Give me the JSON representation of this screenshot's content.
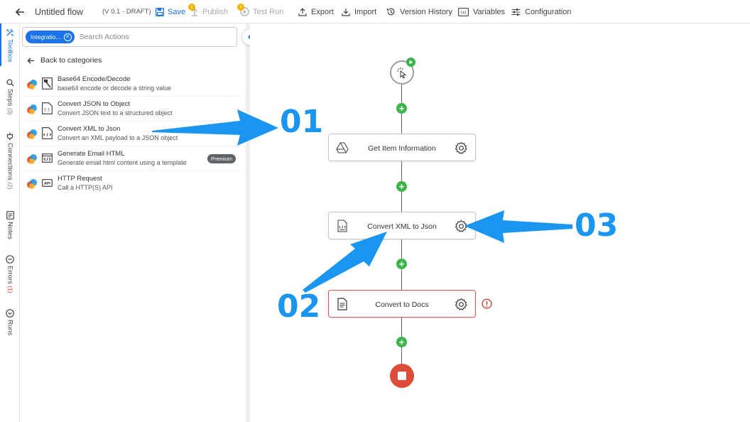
{
  "header": {
    "title": "Untitled flow",
    "version": "(V 0.1 - DRAFT)",
    "save": "Save",
    "publish": "Publish",
    "test_run": "Test Run",
    "export": "Export",
    "import": "Import",
    "version_history": "Version History",
    "variables": "Variables",
    "configuration": "Configuration",
    "publish_badge": "!",
    "test_run_badge": "!"
  },
  "rail": {
    "toolbox": "Toolbox",
    "steps": "Steps",
    "steps_count": "(3)",
    "connections": "Connections",
    "connections_count": "(2)",
    "notes": "Notes",
    "errors": "Errors",
    "errors_count": "(1)",
    "runs": "Runs"
  },
  "toolbox": {
    "filter_chip": "Integratio...",
    "search_placeholder": "Search Actions",
    "back_label": "Back to categories",
    "actions": [
      {
        "name": "Base64 Encode/Decode",
        "description": "base64 encode or decode a string value",
        "badge": ""
      },
      {
        "name": "Convert JSON to Object",
        "description": "Convert JSON text to a structured object",
        "badge": ""
      },
      {
        "name": "Convert XML to Json",
        "description": "Convert an XML payload to a JSON object",
        "badge": ""
      },
      {
        "name": "Generate Email HTML",
        "description": "Generate email html content using a template",
        "badge": "Premium"
      },
      {
        "name": "HTTP Request",
        "description": "Call a HTTP(S) API",
        "badge": ""
      }
    ]
  },
  "canvas": {
    "steps": [
      {
        "label": "Get Item Information",
        "icon": "google-drive-icon",
        "state": "ok"
      },
      {
        "label": "Convert XML to Json",
        "icon": "xml-file-icon",
        "state": "ok"
      },
      {
        "label": "Convert to Docs",
        "icon": "document-icon",
        "state": "error"
      }
    ]
  },
  "annotations": {
    "n1": "01",
    "n2": "02",
    "n3": "03",
    "color": "#1a95f0"
  },
  "colors": {
    "accent": "#1a73e8",
    "add": "#3bb54a",
    "error": "#d9534f",
    "end": "#dd4b39",
    "warning": "#f2b400"
  }
}
